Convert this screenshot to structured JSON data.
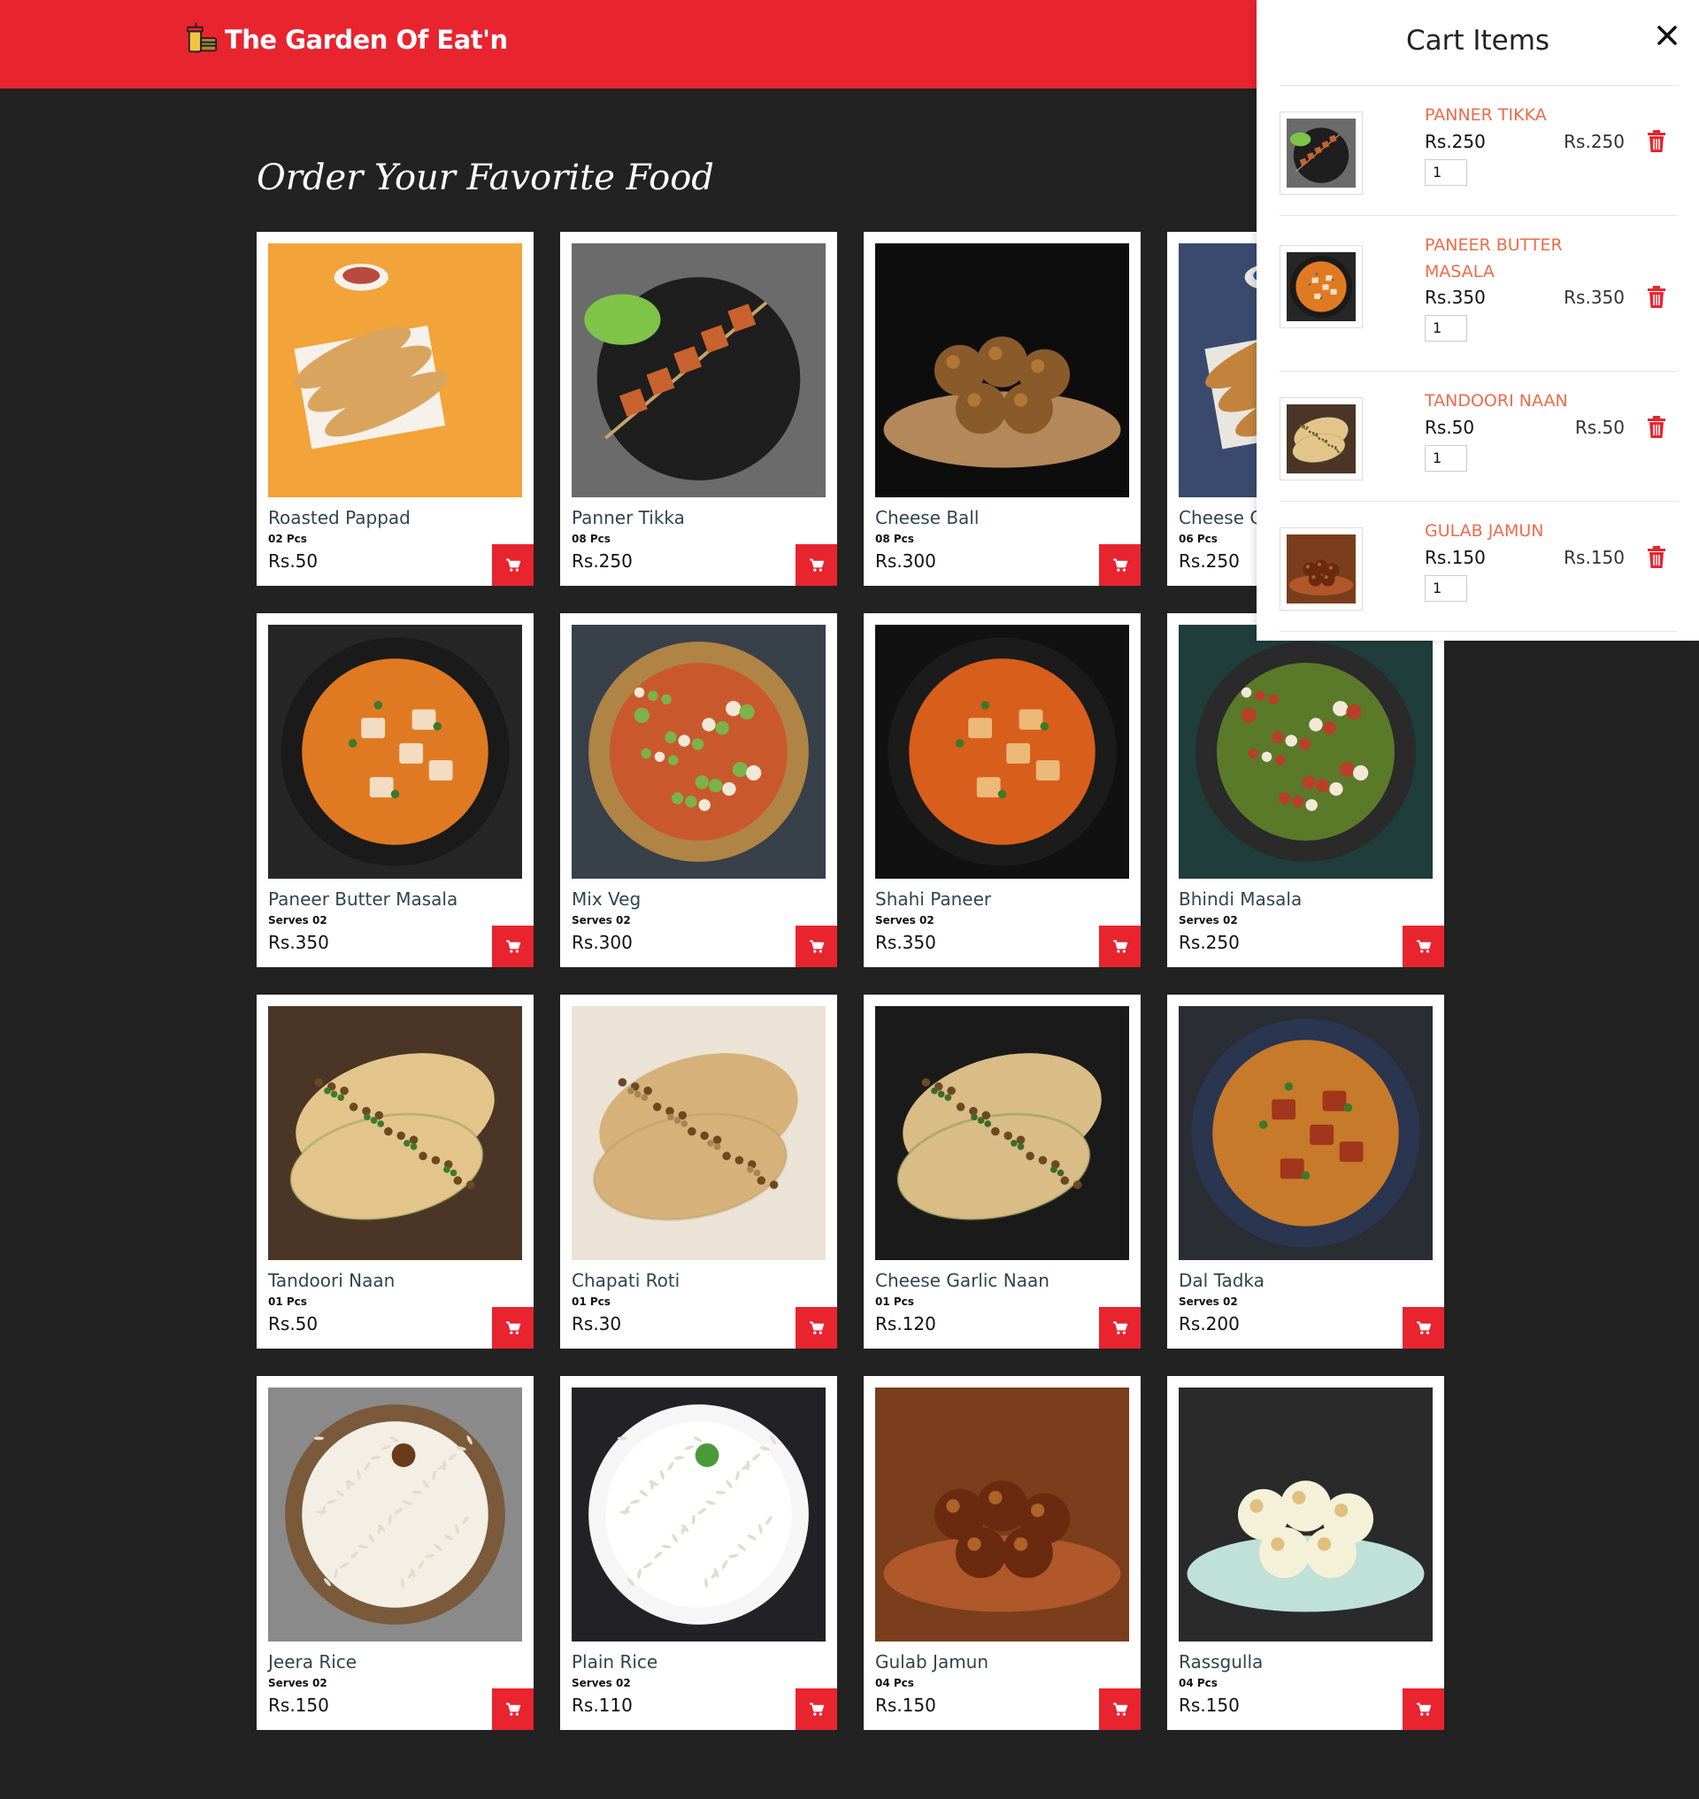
{
  "header": {
    "brand_name": "The Garden Of Eat'n",
    "brand_icon": "fast-food-icon",
    "background": "#e8242f"
  },
  "menu": {
    "title": "Order Your Favorite Food",
    "items": [
      {
        "name": "Roasted Pappad",
        "qty": "02 Pcs",
        "price": "Rs.50"
      },
      {
        "name": "Panner Tikka",
        "qty": "08 Pcs",
        "price": "Rs.250"
      },
      {
        "name": "Cheese Ball",
        "qty": "08 Pcs",
        "price": "Rs.300"
      },
      {
        "name": "Cheese C",
        "qty": "06 Pcs",
        "price": "Rs.250"
      },
      {
        "name": "Paneer Butter Masala",
        "qty": "Serves 02",
        "price": "Rs.350"
      },
      {
        "name": "Mix Veg",
        "qty": "Serves 02",
        "price": "Rs.300"
      },
      {
        "name": "Shahi Paneer",
        "qty": "Serves 02",
        "price": "Rs.350"
      },
      {
        "name": "Bhindi Masala",
        "qty": "Serves 02",
        "price": "Rs.250"
      },
      {
        "name": "Tandoori Naan",
        "qty": "01 Pcs",
        "price": "Rs.50"
      },
      {
        "name": "Chapati Roti",
        "qty": "01 Pcs",
        "price": "Rs.30"
      },
      {
        "name": "Cheese Garlic Naan",
        "qty": "01 Pcs",
        "price": "Rs.120"
      },
      {
        "name": "Dal Tadka",
        "qty": "Serves 02",
        "price": "Rs.200"
      },
      {
        "name": "Jeera Rice",
        "qty": "Serves 02",
        "price": "Rs.150"
      },
      {
        "name": "Plain Rice",
        "qty": "Serves 02",
        "price": "Rs.110"
      },
      {
        "name": "Gulab Jamun",
        "qty": "04 Pcs",
        "price": "Rs.150"
      },
      {
        "name": "Rassgulla",
        "qty": "04 Pcs",
        "price": "Rs.150"
      }
    ],
    "add_icon": "shopping-cart-icon"
  },
  "cart": {
    "title": "Cart Items",
    "close_icon": "close-icon",
    "delete_icon": "trash-icon",
    "items": [
      {
        "name": "PANNER TIKKA",
        "price": "Rs.250",
        "total": "Rs.250",
        "qty": "1"
      },
      {
        "name": "PANEER BUTTER MASALA",
        "price": "Rs.350",
        "total": "Rs.350",
        "qty": "1"
      },
      {
        "name": "TANDOORI NAAN",
        "price": "Rs.50",
        "total": "Rs.50",
        "qty": "1"
      },
      {
        "name": "GULAB JAMUN",
        "price": "Rs.150",
        "total": "Rs.150",
        "qty": "1"
      }
    ]
  }
}
